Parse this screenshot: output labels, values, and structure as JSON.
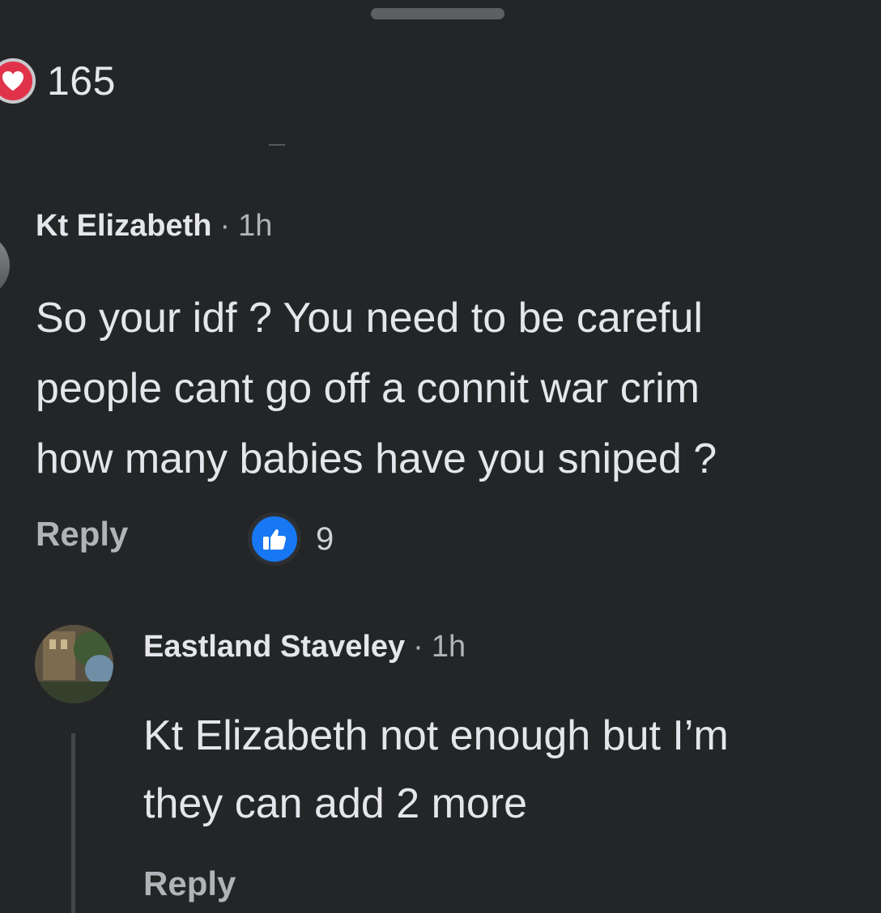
{
  "top_reaction": {
    "icon": "heart-icon",
    "count": "165",
    "color": "#e0334a"
  },
  "comments": [
    {
      "author": "Kt Elizabeth",
      "separator": "·",
      "time": "1h",
      "lines": [
        "So your idf ? You need to be careful",
        "people cant go off a connit war crim",
        "how many babies have you sniped ?"
      ],
      "reply_label": "Reply",
      "reaction": {
        "icon": "thumbs-up-icon",
        "count": "9",
        "color": "#1877f2"
      }
    },
    {
      "author": "Eastland Staveley",
      "separator": "·",
      "time": "1h",
      "lines": [
        "Kt Elizabeth not enough but I’m",
        "they can add 2 more"
      ],
      "reply_label": "Reply"
    }
  ]
}
